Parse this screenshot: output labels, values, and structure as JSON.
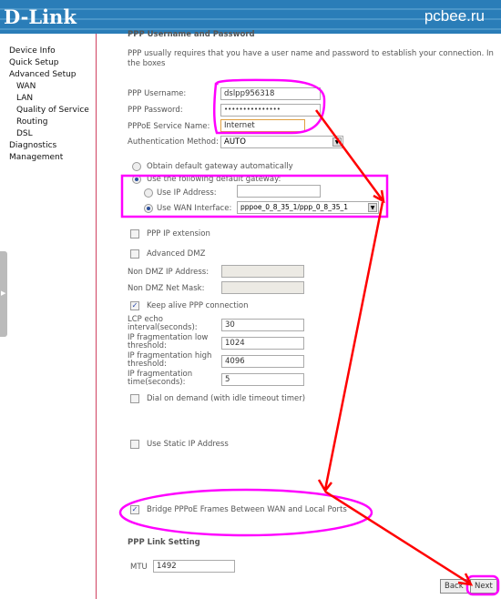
{
  "header": {
    "logo": "D-Link",
    "site": "pcbee.ru"
  },
  "sidebar": {
    "items": [
      "Device Info",
      "Quick Setup",
      "Advanced Setup",
      "WAN",
      "LAN",
      "Quality of Service",
      "Routing",
      "DSL",
      "Diagnostics",
      "Management"
    ]
  },
  "main": {
    "section_title": "PPP Username and Password",
    "description": "PPP usually requires that you have a user name and password to establish your connection. In the boxes",
    "username_label": "PPP Username:",
    "username": "dslpp956318",
    "password_label": "PPP Password:",
    "password": "•••••••••••••••",
    "service_label": "PPPoE Service Name:",
    "service": "Internet",
    "auth_label": "Authentication Method:",
    "auth": "AUTO",
    "gw_auto": "Obtain default gateway automatically",
    "gw_manual": "Use the following default gateway:",
    "use_ip": "Use IP Address:",
    "ip_value": "",
    "use_wan": "Use WAN Interface:",
    "wan_value": "pppoe_0_8_35_1/ppp_0_8_35_1",
    "ppp_ip_ext": "PPP IP extension",
    "adv_dmz": "Advanced DMZ",
    "non_dmz_ip": "Non DMZ IP Address:",
    "non_dmz_mask": "Non DMZ Net Mask:",
    "keep_alive": "Keep alive PPP connection",
    "lcp_label": "LCP echo interval(seconds):",
    "lcp": "30",
    "frag_low_label": "IP fragmentation low threshold:",
    "frag_low": "1024",
    "frag_high_label": "IP fragmentation high threshold:",
    "frag_high": "4096",
    "frag_time_label": "IP fragmentation time(seconds):",
    "frag_time": "5",
    "dial_demand": "Dial on demand (with idle timeout timer)",
    "static_ip": "Use Static IP Address",
    "bridge": "Bridge PPPoE Frames Between WAN and Local Ports",
    "link_title": "PPP Link Setting",
    "mtu_label": "MTU",
    "mtu": "1492",
    "back": "Back",
    "next": "Next"
  },
  "annotation_colors": {
    "highlight": "#ff00ff",
    "arrow": "#ff0000"
  }
}
